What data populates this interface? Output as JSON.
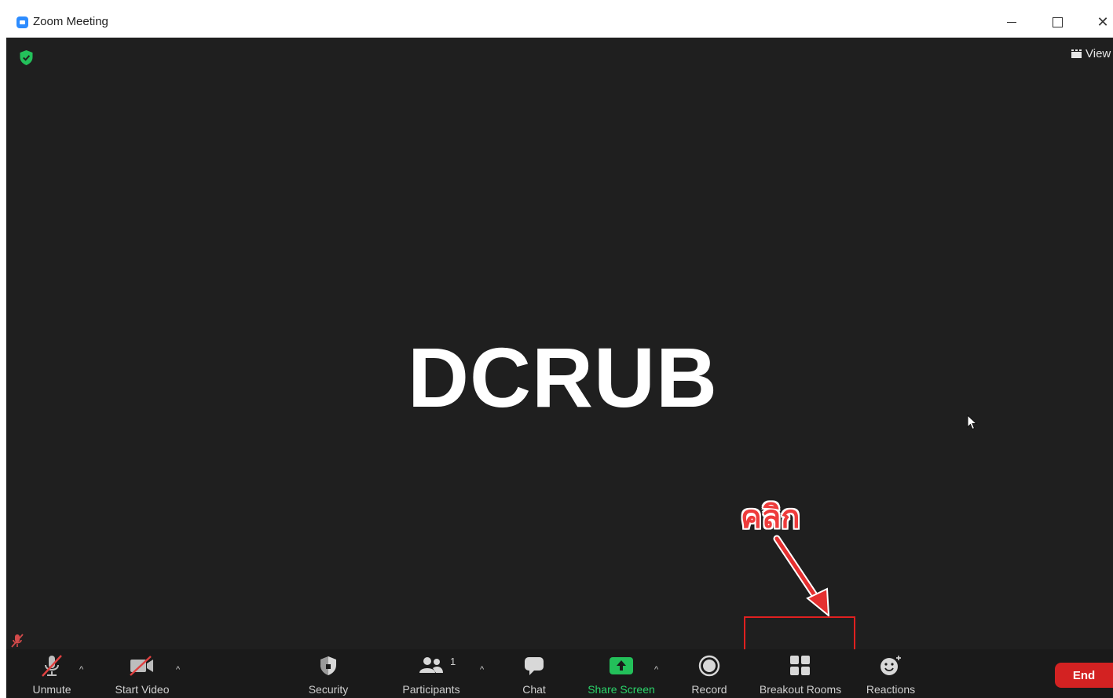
{
  "window": {
    "title": "Zoom Meeting",
    "accent_color": "#2d8cff"
  },
  "top_bar": {
    "view_label": "View"
  },
  "stage": {
    "participant_name": "DCRUB",
    "background_color": "#1f1f1f"
  },
  "annotation": {
    "text": "คลิก",
    "color": "#ee3b3b"
  },
  "toolbar": {
    "unmute_label": "Unmute",
    "start_video_label": "Start Video",
    "security_label": "Security",
    "participants_label": "Participants",
    "participants_count": "1",
    "chat_label": "Chat",
    "share_screen_label": "Share Screen",
    "record_label": "Record",
    "breakout_rooms_label": "Breakout Rooms",
    "reactions_label": "Reactions",
    "end_label": "End",
    "share_color": "#2bd46a",
    "end_color": "#d32222"
  }
}
